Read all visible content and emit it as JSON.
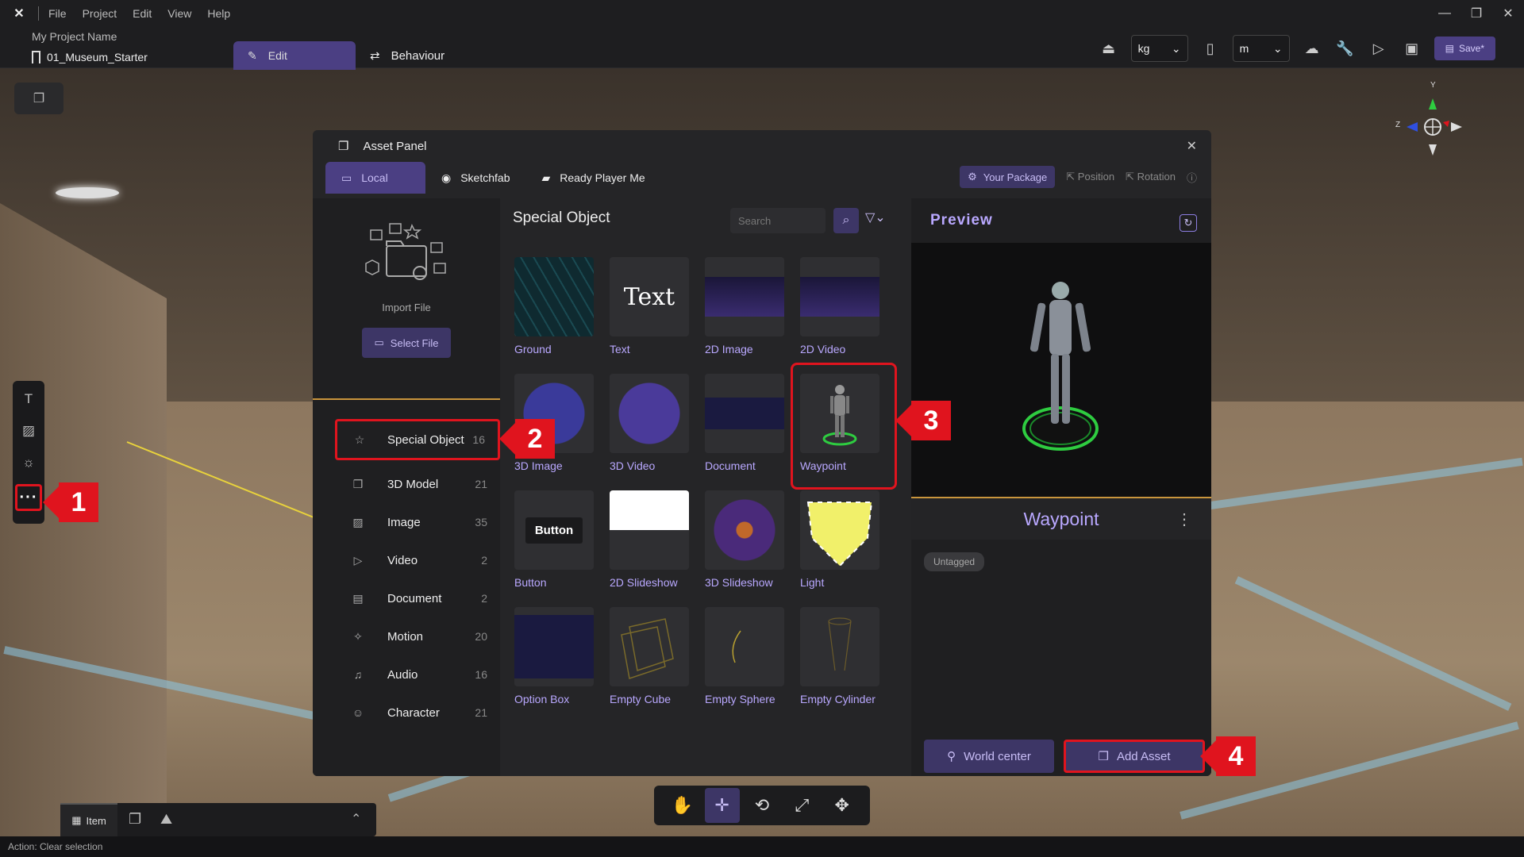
{
  "menu": [
    "File",
    "Project",
    "Edit",
    "View",
    "Help"
  ],
  "project": {
    "name": "My Project Name",
    "scene": "01_Museum_Starter"
  },
  "tabs": {
    "edit": "Edit",
    "behaviour": "Behaviour"
  },
  "units": {
    "mass": "kg",
    "length": "m"
  },
  "save_label": "Save*",
  "gizmo": {
    "y": "Y",
    "z": "Z"
  },
  "asset_panel": {
    "title": "Asset Panel",
    "sources": [
      "Local",
      "Sketchfab",
      "Ready Player Me"
    ],
    "your_package": "Your Package",
    "position": "Position",
    "rotation": "Rotation",
    "import_label": "Import File",
    "select_file": "Select File",
    "categories": [
      {
        "label": "Special Object",
        "count": "16"
      },
      {
        "label": "3D Model",
        "count": "21"
      },
      {
        "label": "Image",
        "count": "35"
      },
      {
        "label": "Video",
        "count": "2"
      },
      {
        "label": "Document",
        "count": "2"
      },
      {
        "label": "Motion",
        "count": "20"
      },
      {
        "label": "Audio",
        "count": "16"
      },
      {
        "label": "Character",
        "count": "21"
      }
    ],
    "section_title": "Special Object",
    "search_placeholder": "Search",
    "items": [
      "Ground",
      "Text",
      "2D Image",
      "2D Video",
      "3D Image",
      "3D Video",
      "Document",
      "Waypoint",
      "Button",
      "2D Slideshow",
      "3D Slideshow",
      "Light",
      "Option Box",
      "Empty Cube",
      "Empty Sphere",
      "Empty Cylinder"
    ],
    "thumb_text": "Text",
    "thumb_button": "Button",
    "preview_title": "Preview",
    "selected_name": "Waypoint",
    "tag": "Untagged",
    "world_center": "World center",
    "add_asset": "Add Asset"
  },
  "callouts": [
    "1",
    "2",
    "3",
    "4"
  ],
  "item_tab": "Item",
  "status": "Action: Clear selection",
  "colors": {
    "accent": "#4b3f83",
    "highlight": "#e0141e",
    "label": "#b9a8ff"
  }
}
